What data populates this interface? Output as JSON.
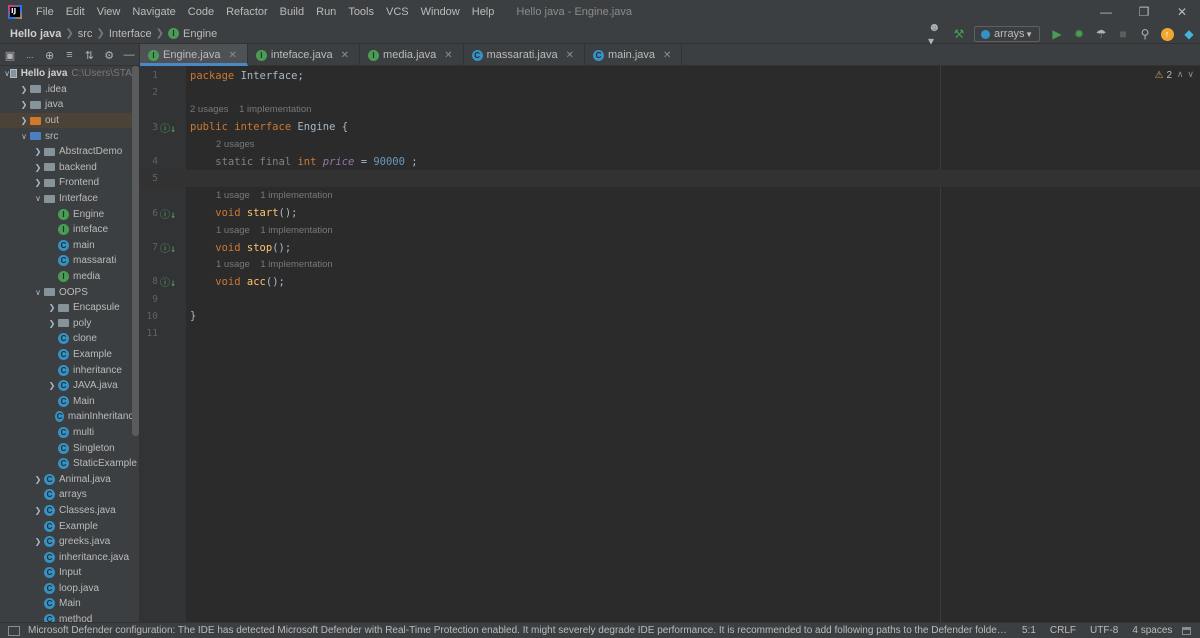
{
  "menu": {
    "items": [
      "File",
      "Edit",
      "View",
      "Navigate",
      "Code",
      "Refactor",
      "Build",
      "Run",
      "Tools",
      "VCS",
      "Window",
      "Help"
    ],
    "window_title": "Hello java - Engine.java"
  },
  "breadcrumb": {
    "project": "Hello java",
    "src": "src",
    "package": "Interface",
    "file": "Engine"
  },
  "run": {
    "config_label": "arrays"
  },
  "tabs": [
    {
      "label": "Engine.java",
      "kind": "interface",
      "active": true
    },
    {
      "label": "inteface.java",
      "kind": "interface",
      "active": false
    },
    {
      "label": "media.java",
      "kind": "interface",
      "active": false
    },
    {
      "label": "massarati.java",
      "kind": "class",
      "active": false
    },
    {
      "label": "main.java",
      "kind": "class",
      "active": false
    }
  ],
  "project": {
    "root_label": "Hello java",
    "root_path": "C:\\Users\\STAR",
    "tree": [
      {
        "label": ".idea",
        "depth": 1,
        "type": "folder",
        "arrow": ">"
      },
      {
        "label": "java",
        "depth": 1,
        "type": "folder",
        "arrow": ">"
      },
      {
        "label": "out",
        "depth": 1,
        "type": "folder-orange",
        "arrow": ">",
        "selected": true
      },
      {
        "label": "src",
        "depth": 1,
        "type": "folder-src",
        "arrow": "v"
      },
      {
        "label": "AbstractDemo",
        "depth": 2,
        "type": "folder",
        "arrow": ">"
      },
      {
        "label": "backend",
        "depth": 2,
        "type": "folder",
        "arrow": ">"
      },
      {
        "label": "Frontend",
        "depth": 2,
        "type": "folder",
        "arrow": ">"
      },
      {
        "label": "Interface",
        "depth": 2,
        "type": "folder",
        "arrow": "v"
      },
      {
        "label": "Engine",
        "depth": 3,
        "type": "interface"
      },
      {
        "label": "inteface",
        "depth": 3,
        "type": "interface"
      },
      {
        "label": "main",
        "depth": 3,
        "type": "class"
      },
      {
        "label": "massarati",
        "depth": 3,
        "type": "class"
      },
      {
        "label": "media",
        "depth": 3,
        "type": "interface"
      },
      {
        "label": "OOPS",
        "depth": 2,
        "type": "folder",
        "arrow": "v"
      },
      {
        "label": "Encapsule",
        "depth": 3,
        "type": "folder",
        "arrow": ">"
      },
      {
        "label": "poly",
        "depth": 3,
        "type": "folder",
        "arrow": ">"
      },
      {
        "label": "clone",
        "depth": 3,
        "type": "class"
      },
      {
        "label": "Example",
        "depth": 3,
        "type": "class"
      },
      {
        "label": "inheritance",
        "depth": 3,
        "type": "class"
      },
      {
        "label": "JAVA.java",
        "depth": 3,
        "type": "class",
        "arrow": ">"
      },
      {
        "label": "Main",
        "depth": 3,
        "type": "class"
      },
      {
        "label": "mainInheritance",
        "depth": 3,
        "type": "class"
      },
      {
        "label": "multi",
        "depth": 3,
        "type": "class"
      },
      {
        "label": "Singleton",
        "depth": 3,
        "type": "class"
      },
      {
        "label": "StaticExample",
        "depth": 3,
        "type": "class"
      },
      {
        "label": "Animal.java",
        "depth": 2,
        "type": "class",
        "arrow": ">"
      },
      {
        "label": "arrays",
        "depth": 2,
        "type": "class"
      },
      {
        "label": "Classes.java",
        "depth": 2,
        "type": "class",
        "arrow": ">"
      },
      {
        "label": "Example",
        "depth": 2,
        "type": "class"
      },
      {
        "label": "greeks.java",
        "depth": 2,
        "type": "class",
        "arrow": ">"
      },
      {
        "label": "inheritance.java",
        "depth": 2,
        "type": "class"
      },
      {
        "label": "Input",
        "depth": 2,
        "type": "class"
      },
      {
        "label": "loop.java",
        "depth": 2,
        "type": "class"
      },
      {
        "label": "Main",
        "depth": 2,
        "type": "class"
      },
      {
        "label": "method",
        "depth": 2,
        "type": "class"
      }
    ]
  },
  "editor": {
    "warnings": "2",
    "lines": [
      {
        "n": "1",
        "tokens": [
          [
            "kw",
            "package "
          ],
          [
            "",
            "Interface;"
          ]
        ]
      },
      {
        "n": "2",
        "tokens": []
      },
      {
        "hint": "2 usages    1 implementation",
        "indent": 0
      },
      {
        "n": "3",
        "mark": true,
        "tokens": [
          [
            "kw",
            "public interface "
          ],
          [
            "",
            "Engine {"
          ]
        ]
      },
      {
        "hint": "2 usages",
        "indent": 1
      },
      {
        "n": "4",
        "tokens": [
          [
            "stat",
            "    static final "
          ],
          [
            "kw",
            "int "
          ],
          [
            "fld",
            "price"
          ],
          [
            "",
            " = "
          ],
          [
            "num",
            "90000"
          ],
          [
            "",
            " ;"
          ]
        ]
      },
      {
        "n": "5",
        "tokens": [],
        "current": true
      },
      {
        "hint": "1 usage    1 implementation",
        "indent": 1
      },
      {
        "n": "6",
        "mark": true,
        "tokens": [
          [
            "kw",
            "    void "
          ],
          [
            "fn",
            "start"
          ],
          [
            "",
            "();"
          ]
        ]
      },
      {
        "hint": "1 usage    1 implementation",
        "indent": 1
      },
      {
        "n": "7",
        "mark": true,
        "tokens": [
          [
            "kw",
            "    void "
          ],
          [
            "fn",
            "stop"
          ],
          [
            "",
            "();"
          ]
        ]
      },
      {
        "hint": "1 usage    1 implementation",
        "indent": 1
      },
      {
        "n": "8",
        "mark": true,
        "tokens": [
          [
            "kw",
            "    void "
          ],
          [
            "fn",
            "acc"
          ],
          [
            "",
            "();"
          ]
        ]
      },
      {
        "n": "9",
        "tokens": []
      },
      {
        "n": "10",
        "tokens": [
          [
            "",
            "}"
          ]
        ]
      },
      {
        "n": "11",
        "tokens": []
      }
    ]
  },
  "status": {
    "message": "Microsoft Defender configuration: The IDE has detected Microsoft Defender with Real-Time Protection enabled. It might severely degrade IDE performance. It is recommended to add following paths to the Defender folder excl... (momen",
    "position": "5:1",
    "line_sep": "CRLF",
    "encoding": "UTF-8",
    "indent": "4 spaces"
  }
}
